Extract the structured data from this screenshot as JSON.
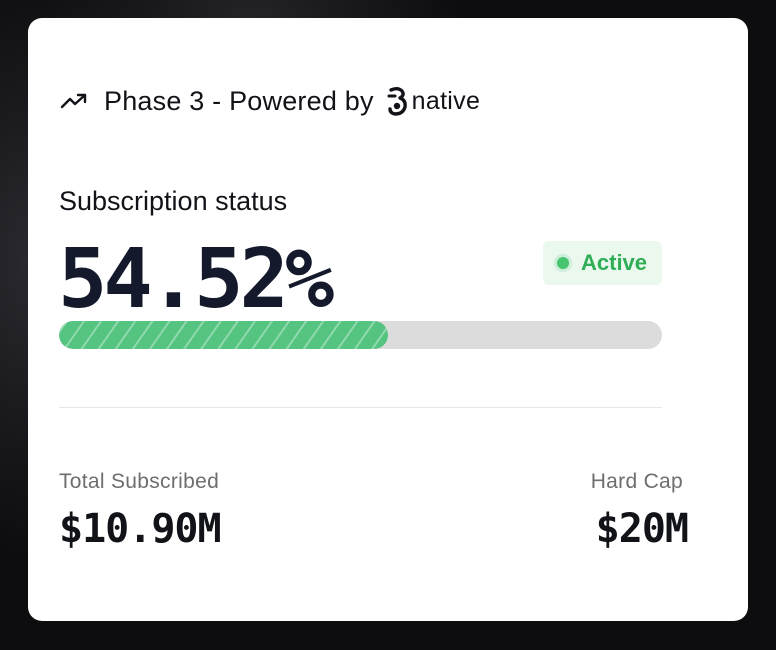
{
  "header": {
    "title": "Phase 3 - Powered by",
    "trend_icon": "trending-up-icon",
    "brand_icon": "native-logo-icon",
    "brand_name": "native"
  },
  "subscription": {
    "label": "Subscription status",
    "percent_text": "54.52%",
    "progress_fraction": 0.5452,
    "status": {
      "label": "Active",
      "color": "#2fae56"
    }
  },
  "stats": {
    "total_subscribed": {
      "label": "Total Subscribed",
      "value": "$10.90M"
    },
    "hard_cap": {
      "label": "Hard Cap",
      "value": "$20M"
    }
  },
  "colors": {
    "progress_fill": "#55c481",
    "progress_track": "#dcdcdc",
    "text_primary": "#111318",
    "card_background": "#ffffff",
    "page_background": "#0d0d0f"
  }
}
